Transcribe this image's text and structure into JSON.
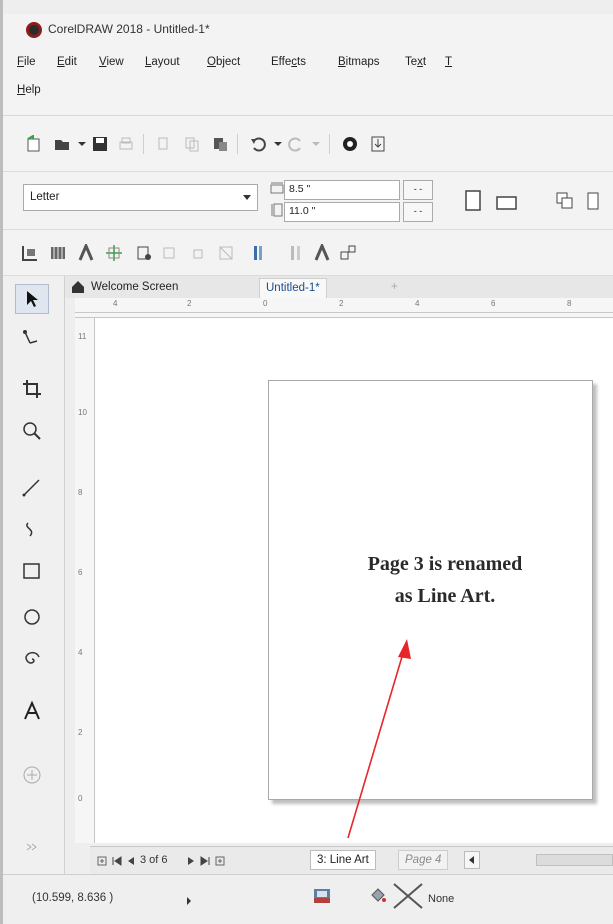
{
  "window": {
    "title": "CorelDRAW 2018 - Untitled-1*"
  },
  "menu": [
    {
      "pre": "",
      "u": "F",
      "post": "ile"
    },
    {
      "pre": "",
      "u": "E",
      "post": "dit"
    },
    {
      "pre": "",
      "u": "V",
      "post": "iew"
    },
    {
      "pre": "",
      "u": "L",
      "post": "ayout"
    },
    {
      "pre": "",
      "u": "O",
      "post": "bject"
    },
    {
      "pre": "Effe",
      "u": "c",
      "post": "ts"
    },
    {
      "pre": "",
      "u": "B",
      "post": "itmaps"
    },
    {
      "pre": "Te",
      "u": "x",
      "post": "t"
    },
    {
      "pre": "",
      "u": "T",
      "post": ""
    },
    {
      "pre": "",
      "u": "H",
      "post": "elp"
    }
  ],
  "property_bar": {
    "paper_size": "Letter",
    "width": "8.5 \"",
    "height": "11.0 \""
  },
  "document_tabs": {
    "welcome": "Welcome Screen",
    "current": "Untitled-1*",
    "add": "+"
  },
  "ruler": {
    "top_labels": [
      "4",
      "2",
      "0",
      "2",
      "4",
      "6",
      "8"
    ],
    "left_labels": [
      "11",
      "10",
      "8",
      "6",
      "4",
      "2",
      "0"
    ]
  },
  "annotation": {
    "line1": "Page 3 is renamed",
    "line2": "as Line Art."
  },
  "page_navigator": {
    "counter": "3 of 6",
    "active_tab": "3: Line Art",
    "next_tab": "Page 4"
  },
  "status": {
    "coords": "(10.599, 8.636 )",
    "fill": "None"
  },
  "colors": {
    "arrow": "#e8262a",
    "logo_ring": "#8d1c1c",
    "tab_text": "#1b4d8a"
  }
}
